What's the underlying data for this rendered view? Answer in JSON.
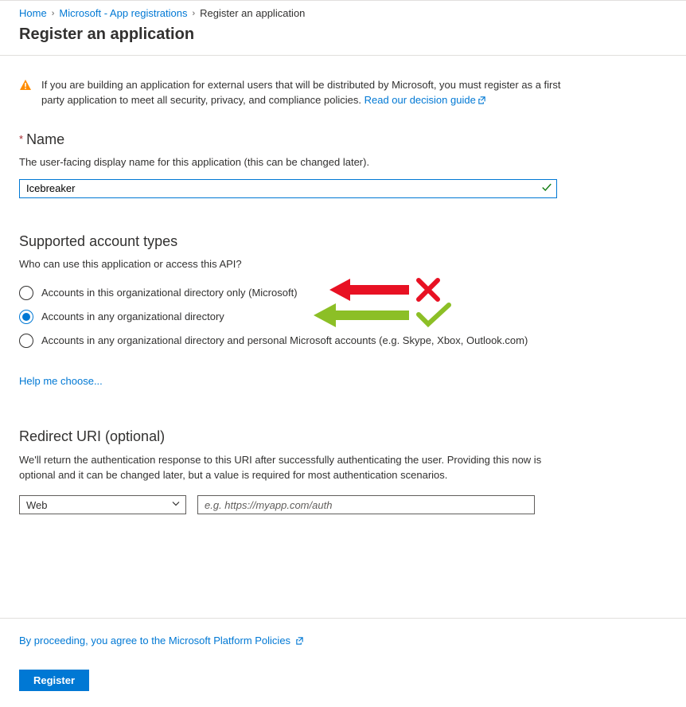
{
  "breadcrumb": {
    "items": [
      {
        "label": "Home",
        "link": true
      },
      {
        "label": "Microsoft - App registrations",
        "link": true
      },
      {
        "label": "Register an application",
        "link": false
      }
    ]
  },
  "page_title": "Register an application",
  "alert": {
    "icon": "warning-triangle",
    "text": "If you are building an application for external users that will be distributed by Microsoft, you must register as a first party application to meet all security, privacy, and compliance policies. ",
    "link_text": "Read our decision guide"
  },
  "name_section": {
    "label": "Name",
    "required": true,
    "help": "The user-facing display name for this application (this can be changed later).",
    "value": "Icebreaker",
    "valid": true
  },
  "account_types": {
    "heading": "Supported account types",
    "help": "Who can use this application or access this API?",
    "options": [
      {
        "label": "Accounts in this organizational directory only (Microsoft)",
        "checked": false
      },
      {
        "label": "Accounts in any organizational directory",
        "checked": true
      },
      {
        "label": "Accounts in any organizational directory and personal Microsoft accounts (e.g. Skype, Xbox, Outlook.com)",
        "checked": false
      }
    ],
    "help_link": "Help me choose..."
  },
  "annotations": {
    "wrong": {
      "color": "#E81123",
      "icon": "x-mark"
    },
    "correct": {
      "color": "#8CBF26",
      "icon": "check-mark"
    }
  },
  "redirect": {
    "heading": "Redirect URI (optional)",
    "help": "We'll return the authentication response to this URI after successfully authenticating the user. Providing this now is optional and it can be changed later, but a value is required for most authentication scenarios.",
    "platform_selected": "Web",
    "uri_value": "",
    "uri_placeholder": "e.g. https://myapp.com/auth"
  },
  "footer": {
    "policies_text": "By proceeding, you agree to the Microsoft Platform Policies",
    "register_label": "Register"
  }
}
